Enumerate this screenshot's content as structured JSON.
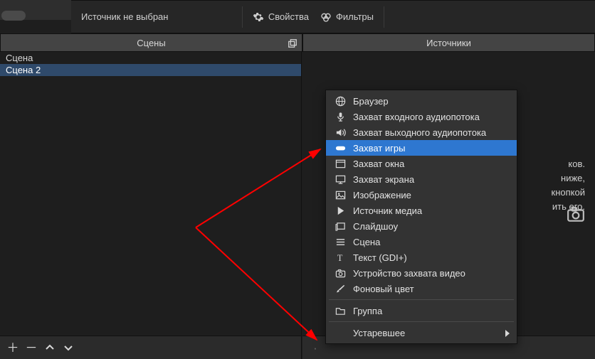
{
  "status": {
    "no_source": "Источник не выбран",
    "properties": "Свойства",
    "filters": "Фильтры"
  },
  "docks": {
    "scenes_title": "Сцены",
    "sources_title": "Источники"
  },
  "scenes": {
    "items": [
      {
        "label": "Сцена",
        "selected": false
      },
      {
        "label": "Сцена 2",
        "selected": true
      }
    ]
  },
  "sources_hint": {
    "l1": "ков.",
    "l2": "ниже,",
    "l3": "кнопкой",
    "l4": "ить его."
  },
  "ctx": {
    "items": [
      {
        "icon": "globe",
        "label": "Браузер"
      },
      {
        "icon": "mic",
        "label": "Захват входного аудиопотока"
      },
      {
        "icon": "speaker",
        "label": "Захват выходного аудиопотока"
      },
      {
        "icon": "gamepad",
        "label": "Захват игры",
        "selected": true
      },
      {
        "icon": "window",
        "label": "Захват окна"
      },
      {
        "icon": "monitor",
        "label": "Захват экрана"
      },
      {
        "icon": "image",
        "label": "Изображение"
      },
      {
        "icon": "play",
        "label": "Источник медиа"
      },
      {
        "icon": "slideshow",
        "label": "Слайдшоу"
      },
      {
        "icon": "lines",
        "label": "Сцена"
      },
      {
        "icon": "text",
        "label": "Текст (GDI+)"
      },
      {
        "icon": "camera",
        "label": "Устройство захвата видео"
      },
      {
        "icon": "brush",
        "label": "Фоновый цвет"
      }
    ],
    "group": "Группа",
    "deprecated": "Устаревшее"
  }
}
